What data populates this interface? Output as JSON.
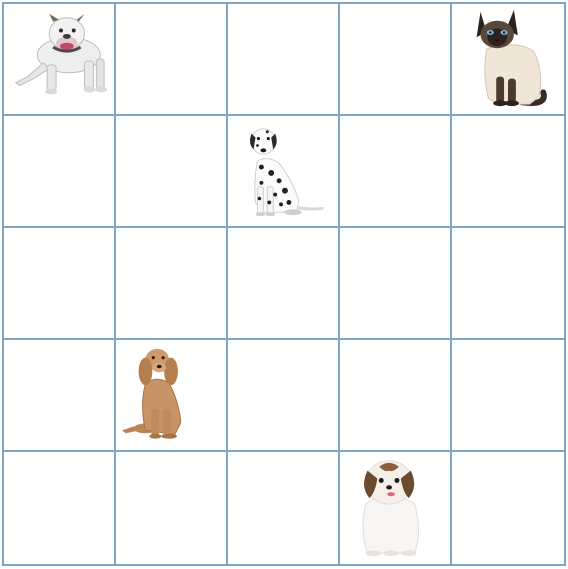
{
  "board": {
    "rows": 5,
    "cols": 5,
    "grid_color": "#7ea6c4",
    "pieces": [
      {
        "row": 0,
        "col": 0,
        "icon": "bulldog-icon",
        "animal": "dog"
      },
      {
        "row": 0,
        "col": 4,
        "icon": "siamese-cat-icon",
        "animal": "cat"
      },
      {
        "row": 1,
        "col": 2,
        "icon": "dalmatian-icon",
        "animal": "dog"
      },
      {
        "row": 3,
        "col": 1,
        "icon": "cocker-spaniel-icon",
        "animal": "dog"
      },
      {
        "row": 4,
        "col": 3,
        "icon": "shih-tzu-icon",
        "animal": "dog"
      }
    ]
  }
}
